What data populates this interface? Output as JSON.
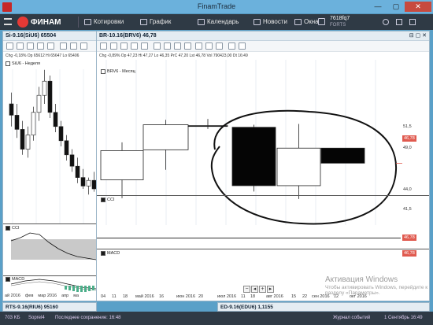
{
  "window": {
    "title": "FinamTrade",
    "min": "—",
    "max": "▢",
    "close": "✕"
  },
  "nav": {
    "logo": "ФИНАМ",
    "items": [
      {
        "label": "Котировки",
        "icon": "quotes-icon"
      },
      {
        "label": "График",
        "icon": "chart-icon"
      },
      {
        "label": "Календарь",
        "icon": "calendar-icon"
      },
      {
        "label": "Новости",
        "icon": "news-icon"
      },
      {
        "label": "Окна",
        "icon": "windows-icon"
      }
    ],
    "account": {
      "id": "7618fq7",
      "sub": "FORTS"
    }
  },
  "left_panel": {
    "title": "Si-9.16(SiU6) 65504",
    "info": "Chg -0,18%  Op 65612  Hi 65647  Lo 65406",
    "main_label": "SiU6 - Неделя",
    "cci_label": "CCI",
    "macd_label": "MACD",
    "x_ticks": [
      "ай 2016",
      "фев",
      "мар 2016",
      "апр",
      "ма"
    ]
  },
  "right_panel": {
    "title": "BR-10.16(BRV6) 46,78",
    "title_ctl": "⊟ ▢ ✕",
    "info": "Chg -0,89%  Op 47,23  Hi 47,27  Lo 46,35  PrC 47,20  Lst 46,78  Vol 790423,00  Dt 16:49",
    "main_label": "BRV6 - Месяц",
    "cci_label": "CCI",
    "macd_label": "MACD",
    "y_ticks": [
      "51,5",
      "49,0",
      "46,5",
      "44,0",
      "41,5"
    ],
    "last_price": "46,78",
    "cci_price": "46,78",
    "macd_price": "46,78",
    "x_ticks": [
      "04",
      "11",
      "18",
      "май 2016",
      "16",
      "июн 2016",
      "20",
      "июл 2016",
      "11",
      "18",
      "авг 2016",
      "15",
      "22",
      "сен 2016",
      "12",
      "окт 2016"
    ],
    "scroll": {
      "minus": "−",
      "left": "◂",
      "plus": "+",
      "right": "▸"
    }
  },
  "chart_data": {
    "type": "candlestick",
    "symbol": "BRV6",
    "period": "Месяц",
    "y_axis_ticks": [
      51.5,
      49.0,
      46.5,
      44.0,
      41.5
    ],
    "candles": [
      {
        "open": 44.8,
        "high": 49.3,
        "low": 42.6,
        "close": 48.3
      },
      {
        "open": 48.4,
        "high": 52.0,
        "low": 46.0,
        "close": 51.4
      },
      {
        "open": 51.3,
        "high": 52.1,
        "low": 50.9,
        "close": 51.2
      },
      {
        "open": 51.1,
        "high": 51.4,
        "low": 43.4,
        "close": 44.1
      },
      {
        "open": 44.1,
        "high": 51.5,
        "low": 42.5,
        "close": 48.6
      },
      {
        "open": 48.6,
        "high": 48.6,
        "low": 46.9,
        "close": 46.8
      }
    ]
  },
  "left_chart": {
    "candles": [
      {
        "open": 80.0,
        "high": 82.0,
        "low": 76.0,
        "close": 78.0
      },
      {
        "open": 78.0,
        "high": 80.0,
        "low": 74.0,
        "close": 75.5
      },
      {
        "open": 75.5,
        "high": 77.0,
        "low": 71.0,
        "close": 72.0
      },
      {
        "open": 72.0,
        "high": 76.0,
        "low": 70.5,
        "close": 74.5
      },
      {
        "open": 74.5,
        "high": 79.5,
        "low": 73.5,
        "close": 78.5
      },
      {
        "open": 78.5,
        "high": 83.0,
        "low": 77.0,
        "close": 81.5
      },
      {
        "open": 81.5,
        "high": 86.0,
        "low": 80.0,
        "close": 84.0
      },
      {
        "open": 84.0,
        "high": 85.0,
        "low": 77.5,
        "close": 78.5
      },
      {
        "open": 78.5,
        "high": 80.0,
        "low": 75.0,
        "close": 76.0
      },
      {
        "open": 76.0,
        "high": 77.0,
        "low": 72.5,
        "close": 73.5
      },
      {
        "open": 73.5,
        "high": 74.5,
        "low": 70.0,
        "close": 71.0
      },
      {
        "open": 71.0,
        "high": 72.0,
        "low": 68.0,
        "close": 69.0
      },
      {
        "open": 69.0,
        "high": 70.5,
        "low": 66.0,
        "close": 67.0
      },
      {
        "open": 67.0,
        "high": 68.5,
        "low": 65.0,
        "close": 65.5
      },
      {
        "open": 65.5,
        "high": 67.0,
        "low": 64.0,
        "close": 66.5
      },
      {
        "open": 66.5,
        "high": 68.0,
        "low": 64.5,
        "close": 65.0
      }
    ]
  },
  "bottom": {
    "left_tab": "RTS-9.16(RIU6) 95160",
    "right_tab": "ED-9.16(EDU6) 1,1155"
  },
  "status": {
    "conn": "703 KБ",
    "sync": "Soprel4",
    "save": "Последнее сохранение: 16:48",
    "journal": "Журнал событий",
    "date": "1 Сентябрь 16:49"
  },
  "watermark": {
    "line1": "Активация Windows",
    "line2": "Чтобы активировать Windows, перейдите к разделу «Параметры»."
  }
}
